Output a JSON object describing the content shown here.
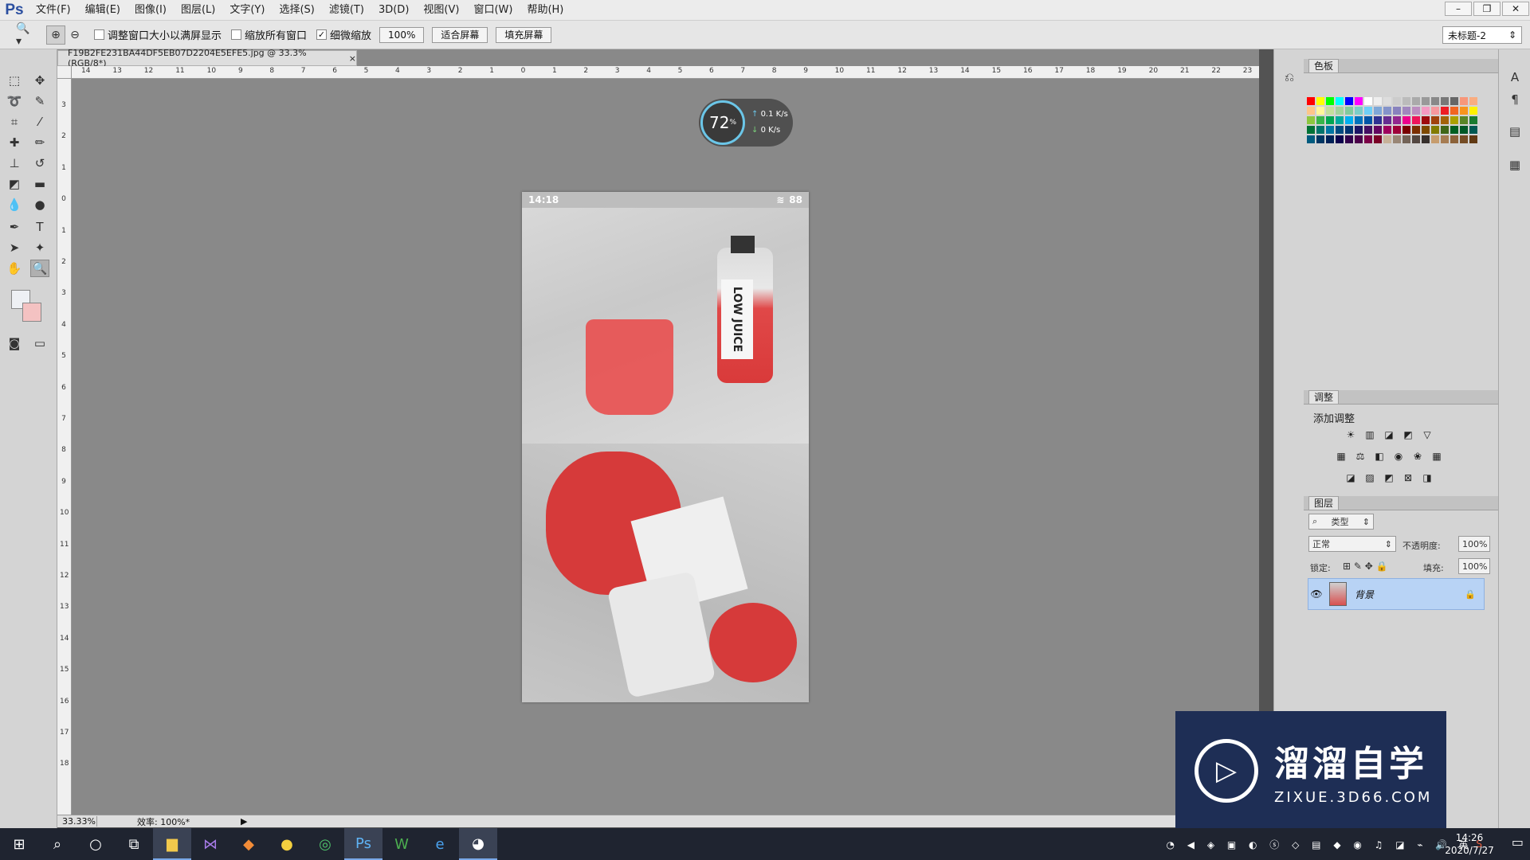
{
  "app": {
    "logo": "Ps"
  },
  "menu": [
    "文件(F)",
    "编辑(E)",
    "图像(I)",
    "图层(L)",
    "文字(Y)",
    "选择(S)",
    "滤镜(T)",
    "3D(D)",
    "视图(V)",
    "窗口(W)",
    "帮助(H)"
  ],
  "window_controls": {
    "minimize": "–",
    "restore": "❐",
    "close": "✕"
  },
  "options": {
    "resize_window_label": "调整窗口大小以满屏显示",
    "resize_window_checked": false,
    "zoom_all_label": "缩放所有窗口",
    "zoom_all_checked": false,
    "scrubby_label": "细微缩放",
    "scrubby_checked": true,
    "zoom_value": "100%",
    "fit_screen": "适合屏幕",
    "fill_screen": "填充屏幕",
    "workspace": "未标题-2"
  },
  "document": {
    "tab_title": "F19B2FE231BA44DF5EB07D2204E5EFE5.jpg @ 33.3%(RGB/8*)",
    "tab_close": "×",
    "zoom_status": "33.33%",
    "efficiency": "效率: 100%*"
  },
  "ruler_h": [
    "14",
    "13",
    "12",
    "11",
    "10",
    "9",
    "8",
    "7",
    "6",
    "5",
    "4",
    "3",
    "2",
    "1",
    "0",
    "1",
    "2",
    "3",
    "4",
    "5",
    "6",
    "7",
    "8",
    "9",
    "10",
    "11",
    "12",
    "13",
    "14",
    "15",
    "16",
    "17",
    "18",
    "19",
    "20",
    "21",
    "22",
    "23"
  ],
  "ruler_v": [
    "3",
    "2",
    "1",
    "0",
    "1",
    "2",
    "3",
    "4",
    "5",
    "6",
    "7",
    "8",
    "9",
    "10",
    "11",
    "12",
    "13",
    "14",
    "15",
    "16",
    "17",
    "18"
  ],
  "speed_widget": {
    "percent": "72",
    "unit": "%",
    "up": "0.1",
    "down": "0",
    "rate_unit": "K/s"
  },
  "phone": {
    "time": "14:18",
    "battery": "88",
    "bottle_text": "LOW JUICE"
  },
  "panels": {
    "swatches_tab": "色板",
    "adjust_tab": "调整",
    "adjust_title": "添加调整",
    "layers_tab": "图层",
    "filter_kind": "类型",
    "blend_mode": "正常",
    "opacity_label": "不透明度:",
    "opacity_value": "100%",
    "lock_label": "锁定:",
    "fill_label": "填充:",
    "fill_value": "100%",
    "layer_name": "背景"
  },
  "watermark": {
    "title": "溜溜自学",
    "url": "ZIXUE.3D66.COM"
  },
  "clock": {
    "time": "14:26",
    "date": "2020/7/27"
  },
  "tray": {
    "ime": "英"
  },
  "colors": {
    "accent": "#2b4fa0",
    "layer_selected": "#b8d3f5",
    "taskbar": "#1f2430",
    "watermark_bg": "#1e2e55"
  }
}
